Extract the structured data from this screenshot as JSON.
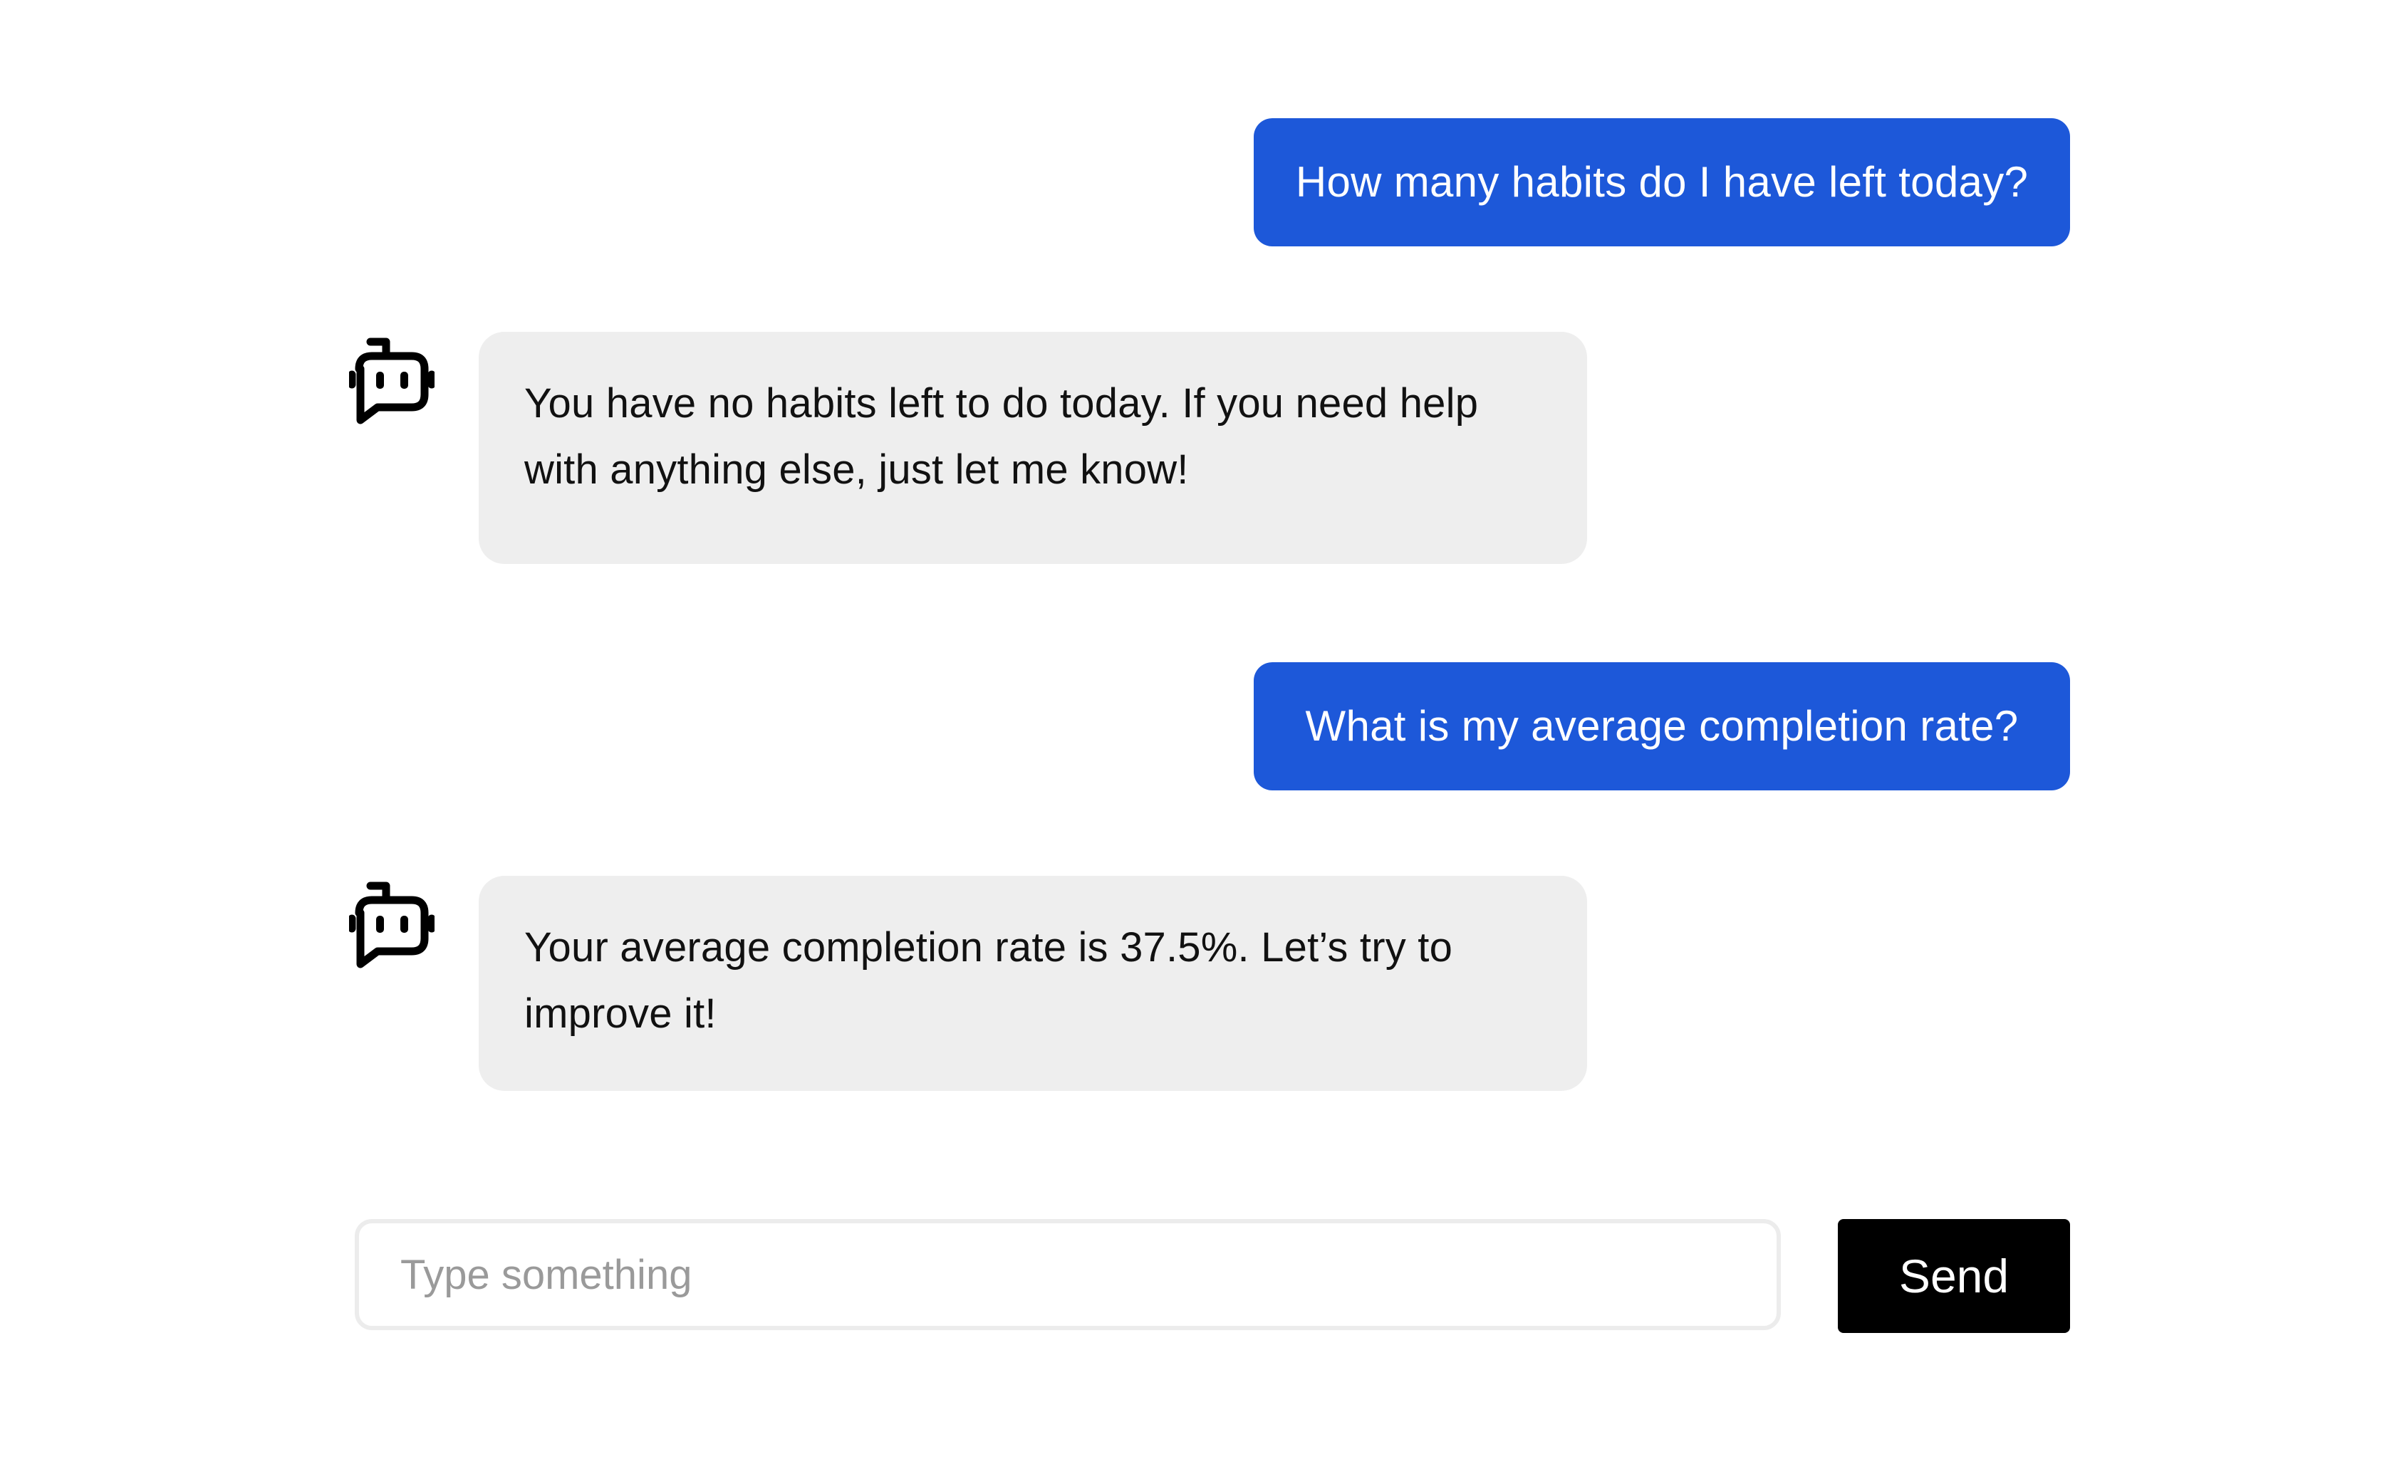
{
  "messages": [
    {
      "role": "user",
      "text": "How many habits do I have left today?"
    },
    {
      "role": "bot",
      "icon": "robot-chat-icon",
      "text": "You have no habits left to do today. If you need help with anything else, just let me know!"
    },
    {
      "role": "user",
      "text": "What is my average completion rate?"
    },
    {
      "role": "bot",
      "icon": "robot-chat-icon",
      "text": "Your average completion rate is 37.5%. Let’s try to improve it!"
    }
  ],
  "composer": {
    "placeholder": "Type something",
    "value": "",
    "send_label": "Send"
  },
  "colors": {
    "user_bubble": "#1d58d9",
    "bot_bubble": "#eeeeee",
    "send_button": "#000000"
  }
}
